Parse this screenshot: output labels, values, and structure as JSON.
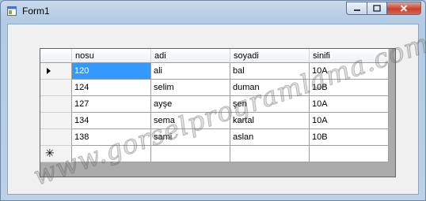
{
  "window": {
    "title": "Form1"
  },
  "grid": {
    "columns": [
      "nosu",
      "adi",
      "soyadi",
      "sinifi"
    ],
    "rows": [
      [
        "120",
        "ali",
        "bal",
        "10A"
      ],
      [
        "124",
        "selim",
        "duman",
        "10B"
      ],
      [
        "127",
        "ayşe",
        "şen",
        "10A"
      ],
      [
        "134",
        "sema",
        "kartal",
        "10A"
      ],
      [
        "138",
        "sami",
        "aslan",
        "10B"
      ]
    ],
    "current_row_marker": "▶",
    "new_row_marker": "✳"
  },
  "watermark": {
    "text": "www.gorselprogramlama.com"
  }
}
